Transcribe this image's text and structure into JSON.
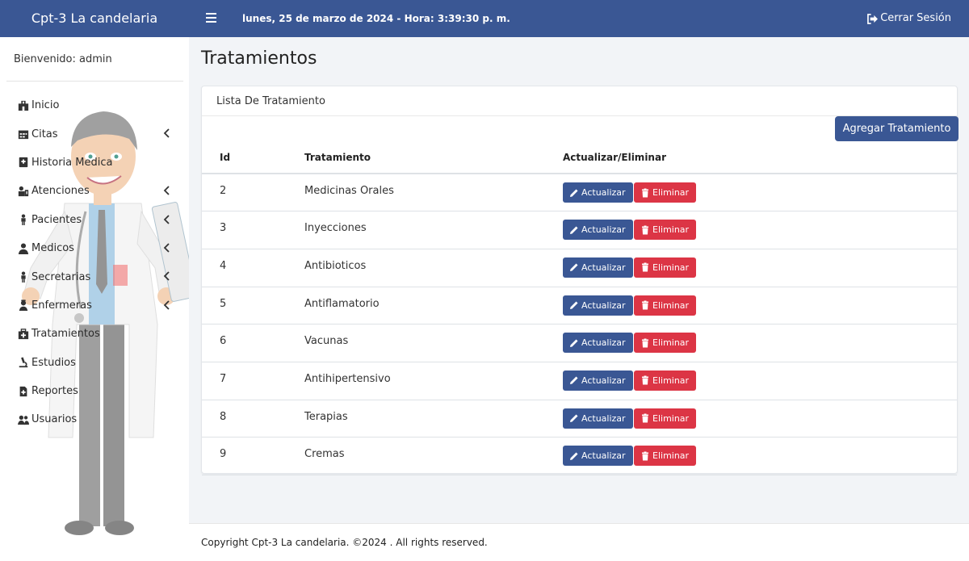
{
  "app": {
    "brand": "Cpt-3 La candelaria",
    "datetime": "lunes, 25 de marzo de 2024 - Hora: 3:39:30 p. m.",
    "logout_label": "Cerrar Sesión"
  },
  "sidebar": {
    "welcome": "Bienvenido: admin",
    "items": [
      {
        "label": "Inicio",
        "icon": "hospital-icon",
        "has_submenu": false
      },
      {
        "label": "Citas",
        "icon": "calendar-icon",
        "has_submenu": true
      },
      {
        "label": "Historia Medica",
        "icon": "medical-file-icon",
        "has_submenu": false
      },
      {
        "label": "Atenciones",
        "icon": "users-medical-icon",
        "has_submenu": true
      },
      {
        "label": "Pacientes",
        "icon": "person-icon",
        "has_submenu": true
      },
      {
        "label": "Medicos",
        "icon": "doctor-icon",
        "has_submenu": true
      },
      {
        "label": "Secretarias",
        "icon": "person-icon",
        "has_submenu": true
      },
      {
        "label": "Enfermeras",
        "icon": "nurse-icon",
        "has_submenu": true
      },
      {
        "label": "Tratamientos",
        "icon": "medkit-icon",
        "has_submenu": false
      },
      {
        "label": "Estudios",
        "icon": "microscope-icon",
        "has_submenu": false
      },
      {
        "label": "Reportes",
        "icon": "report-file-icon",
        "has_submenu": false
      },
      {
        "label": "Usuarios",
        "icon": "users-icon",
        "has_submenu": false
      }
    ]
  },
  "main": {
    "page_title": "Tratamientos",
    "card_title": "Lista De Tratamiento",
    "add_button": "Agregar Tratamiento",
    "columns": [
      "Id",
      "Tratamiento",
      "Actualizar/Eliminar"
    ],
    "update_label": "Actualizar",
    "delete_label": "Eliminar",
    "rows": [
      {
        "id": "2",
        "name": "Medicinas Orales"
      },
      {
        "id": "3",
        "name": "Inyecciones"
      },
      {
        "id": "4",
        "name": "Antibioticos"
      },
      {
        "id": "5",
        "name": "Antiflamatorio"
      },
      {
        "id": "6",
        "name": "Vacunas"
      },
      {
        "id": "7",
        "name": "Antihipertensivo"
      },
      {
        "id": "8",
        "name": "Terapias"
      },
      {
        "id": "9",
        "name": "Cremas"
      }
    ]
  },
  "footer": {
    "copyright": "Copyright Cpt-3 La candelaria. ©2024 . All rights reserved."
  },
  "colors": {
    "primary": "#3a5794",
    "danger": "#dc3545",
    "background": "#f2f4f7"
  }
}
